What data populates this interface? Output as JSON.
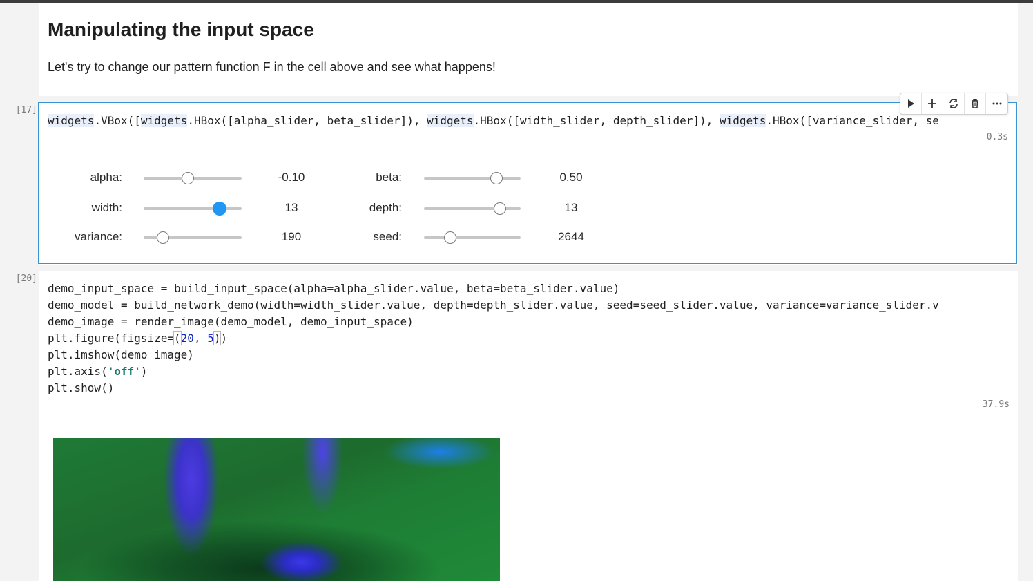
{
  "markdown": {
    "title": "Manipulating the input space",
    "paragraph": "Let's try to change our pattern function F in the cell above and see what happens!"
  },
  "cell_17": {
    "exec_count": "[17]",
    "code": "widgets.VBox([widgets.HBox([alpha_slider, beta_slider]), widgets.HBox([width_slider, depth_slider]), widgets.HBox([variance_slider, se",
    "timing": "0.3s",
    "sliders": [
      {
        "label": "alpha:",
        "value": "-0.10",
        "position": 0.45
      },
      {
        "label": "beta:",
        "value": "0.50",
        "position": 0.75
      },
      {
        "label": "width:",
        "value": "13",
        "position": 0.78
      },
      {
        "label": "depth:",
        "value": "13",
        "position": 0.79
      },
      {
        "label": "variance:",
        "value": "190",
        "position": 0.2
      },
      {
        "label": "seed:",
        "value": "2644",
        "position": 0.28
      }
    ]
  },
  "toolbar": {
    "icons": [
      "run-icon",
      "add-icon",
      "sync-icon",
      "delete-icon",
      "more-icon"
    ]
  },
  "cell_20": {
    "exec_count": "[20]",
    "lines": [
      "demo_input_space = build_input_space(alpha=alpha_slider.value, beta=beta_slider.value)",
      "demo_model = build_network_demo(width=width_slider.value, depth=depth_slider.value, seed=seed_slider.value, variance=variance_slider.v",
      "demo_image = render_image(demo_model, demo_input_space)",
      "plt.figure(figsize=(20, 5))",
      "plt.imshow(demo_image)",
      "plt.axis('off')",
      "plt.show()"
    ],
    "figsize_prefix": "plt.figure(figsize=",
    "figsize_a": "20",
    "figsize_b": "5",
    "axis_prefix": "plt.axis(",
    "axis_arg": "'off'",
    "timing": "37.9s"
  }
}
